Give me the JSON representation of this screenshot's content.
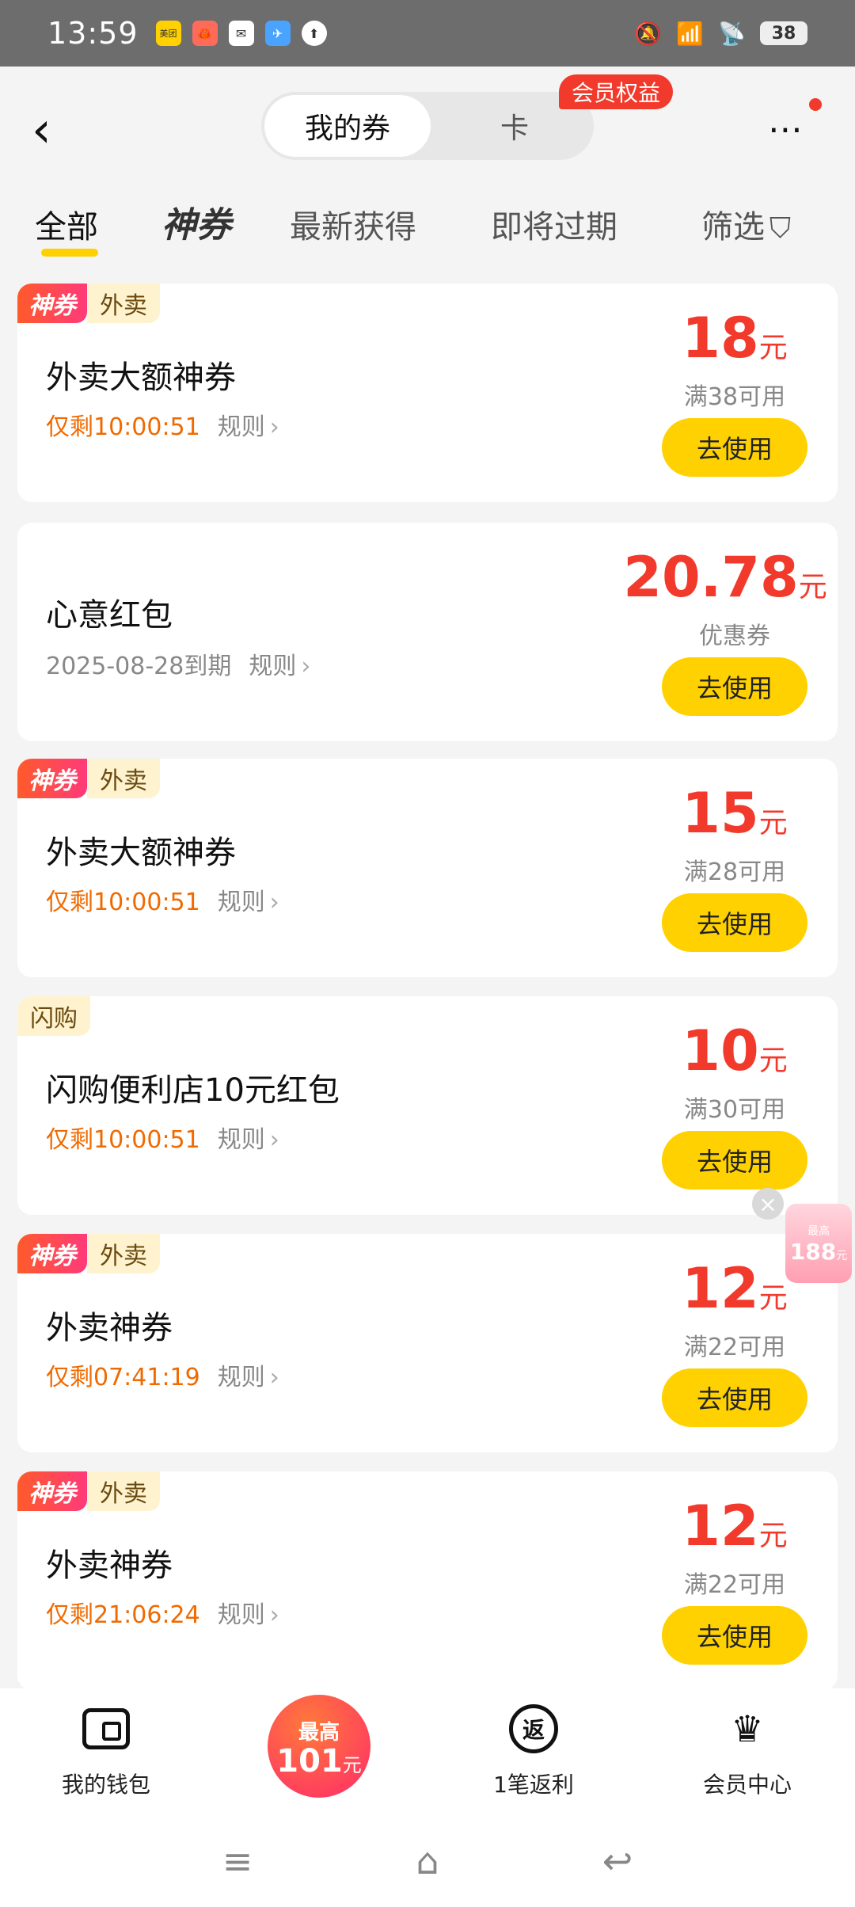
{
  "status_bar": {
    "time": "13:59",
    "app_icons": [
      "美团",
      "🦀",
      "✉",
      "✈",
      "⬆"
    ],
    "right_icons": [
      "🔕",
      "📶",
      "📡"
    ],
    "battery": "38"
  },
  "header": {
    "back_icon": "‹",
    "segments": [
      "我的券",
      "卡"
    ],
    "member_badge": "会员权益",
    "more_icon": "⋯"
  },
  "filter_tabs": {
    "all": "全部",
    "shen": "神券",
    "latest": "最新获得",
    "expiring": "即将过期",
    "filter": "筛选",
    "filter_icon": "⛉"
  },
  "coupons": [
    {
      "shen_tag": "神券",
      "category": "外卖",
      "title": "外卖大额神券",
      "countdown": "仅剩10:00:51",
      "rules": "规则",
      "amount": "18",
      "unit": "元",
      "condition": "满38可用",
      "button": "去使用"
    },
    {
      "title": "心意红包",
      "expiry": "2025-08-28到期",
      "rules": "规则",
      "amount": "20.78",
      "unit": "元",
      "condition": "优惠券",
      "button": "去使用"
    },
    {
      "shen_tag": "神券",
      "category": "外卖",
      "title": "外卖大额神券",
      "countdown": "仅剩10:00:51",
      "rules": "规则",
      "amount": "15",
      "unit": "元",
      "condition": "满28可用",
      "button": "去使用"
    },
    {
      "category": "闪购",
      "title": "闪购便利店10元红包",
      "countdown": "仅剩10:00:51",
      "rules": "规则",
      "amount": "10",
      "unit": "元",
      "condition": "满30可用",
      "button": "去使用"
    },
    {
      "shen_tag": "神券",
      "category": "外卖",
      "title": "外卖神券",
      "countdown": "仅剩07:41:19",
      "rules": "规则",
      "amount": "12",
      "unit": "元",
      "condition": "满22可用",
      "button": "去使用"
    },
    {
      "shen_tag": "神券",
      "category": "外卖",
      "title": "外卖神券",
      "countdown": "仅剩21:06:24",
      "rules": "规则",
      "amount": "12",
      "unit": "元",
      "condition": "满22可用",
      "button": "去使用"
    }
  ],
  "float_promo": {
    "top": "最高",
    "num": "188",
    "unit": "元"
  },
  "bottom_nav": {
    "wallet": "我的钱包",
    "promo_top": "最高",
    "promo_num": "101",
    "promo_unit": "元",
    "rebate_icon": "返",
    "rebate": "1笔返利",
    "member_center": "会员中心"
  },
  "system_nav": {
    "menu": "≡",
    "home": "⌂",
    "back": "↩"
  }
}
